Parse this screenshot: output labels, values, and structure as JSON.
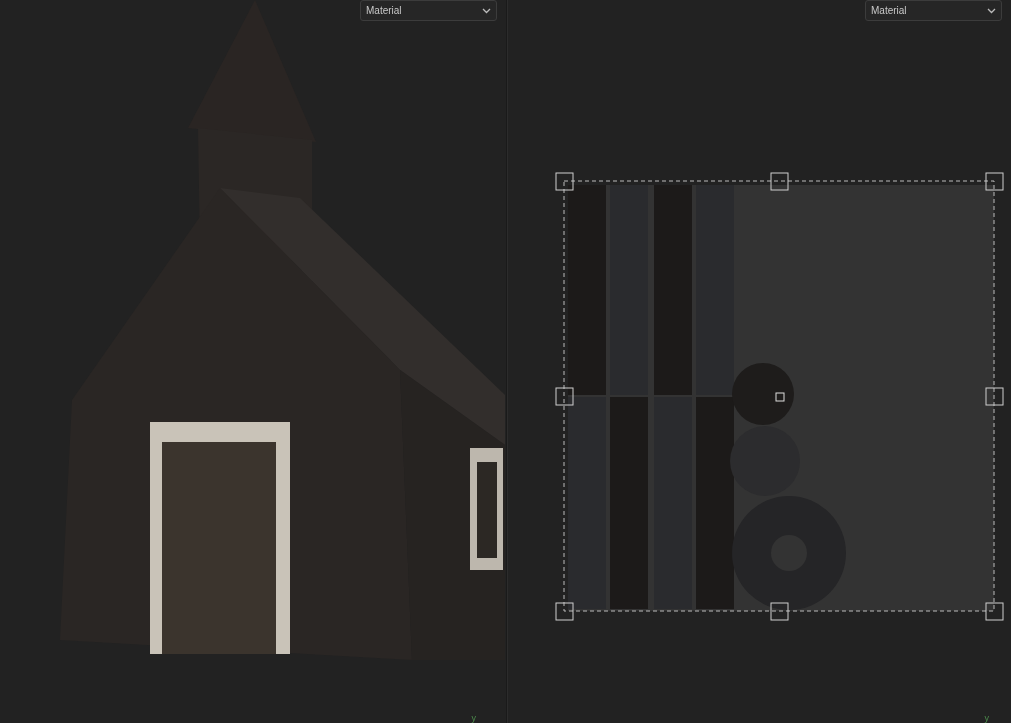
{
  "viewports": [
    {
      "kind": "model",
      "dropdown": "Material",
      "axis_label": "y"
    },
    {
      "kind": "uv",
      "dropdown": "Material",
      "axis_label": "y"
    }
  ]
}
